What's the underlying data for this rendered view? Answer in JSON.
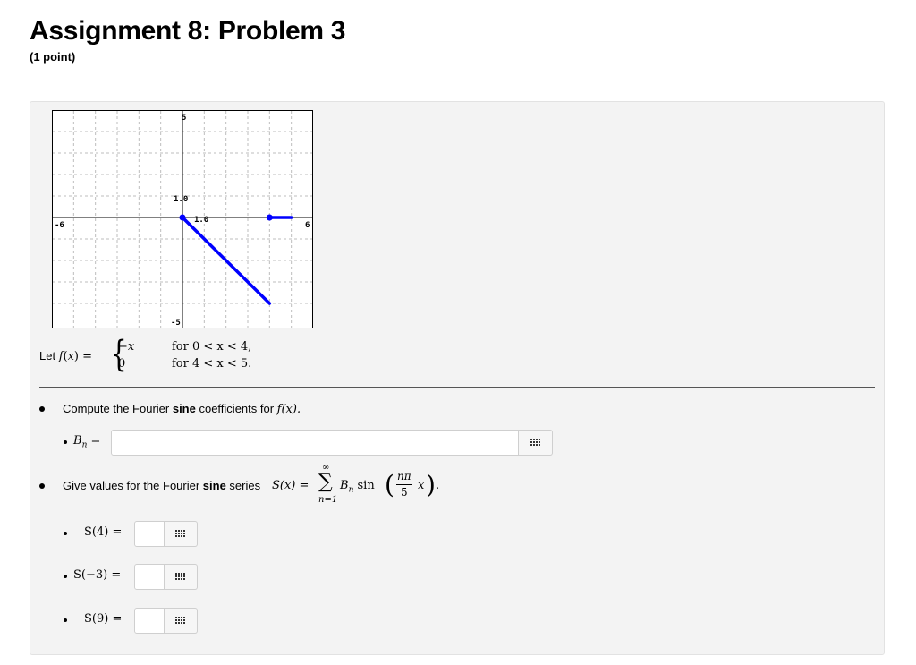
{
  "header": {
    "title": "Assignment 8: Problem 3",
    "points": "(1 point)"
  },
  "graph": {
    "x_left_label": "-6",
    "x_right_label": "6",
    "y_top_label": "5",
    "y_bottom_label": "-5",
    "y_tick_label": "1.0",
    "x_tick_label": "1.0",
    "x_range": [
      -6,
      6
    ],
    "y_range": [
      -5,
      5
    ],
    "segments": [
      {
        "from": [
          0,
          0
        ],
        "to": [
          4,
          -4
        ]
      },
      {
        "from": [
          4,
          0
        ],
        "to": [
          5,
          0
        ]
      }
    ],
    "line_color": "#0000ff"
  },
  "definition": {
    "let": "Let f(x) =",
    "case1_expr": "−x",
    "case1_cond": "for 0 < x < 4,",
    "case2_expr": "0",
    "case2_cond": "for 4 < x < 5."
  },
  "q1": {
    "prefix": "Compute the Fourier ",
    "bold": "sine",
    "suffix": " coefficients for ",
    "fx": "f(x).",
    "label": "Bn =",
    "value": ""
  },
  "q2": {
    "prefix": "Give values for the Fourier ",
    "bold": "sine",
    "suffix": " series ",
    "lhs": "S(x) =",
    "sum_top": "∞",
    "sum_sym": "∑",
    "sum_bottom": "n=1",
    "term": "Bn sin",
    "frac_num": "nπ",
    "frac_den": "5",
    "x": "x",
    "end": "."
  },
  "answers": [
    {
      "label": "S(4) =",
      "value": ""
    },
    {
      "label": "S(−3) =",
      "value": ""
    },
    {
      "label": "S(9) =",
      "value": ""
    }
  ]
}
